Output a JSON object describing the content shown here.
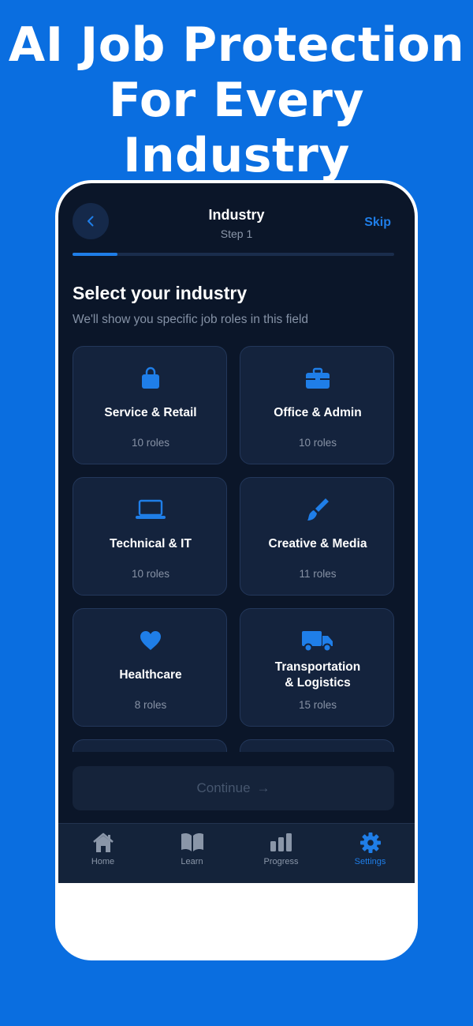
{
  "promo": {
    "line1": "AI Job Protection",
    "line2": "For Every Industry"
  },
  "header": {
    "title": "Industry",
    "step": "Step 1",
    "skip_label": "Skip",
    "back_icon": "chevron-left-icon"
  },
  "progress": {
    "fraction": 0.14
  },
  "heading": "Select your industry",
  "subheading": "We'll show you specific job roles in this field",
  "industries": [
    {
      "name": "Service & Retail",
      "roles": "10 roles",
      "icon": "shopping-bag-icon"
    },
    {
      "name": "Office & Admin",
      "roles": "10 roles",
      "icon": "briefcase-icon"
    },
    {
      "name": "Technical & IT",
      "roles": "10 roles",
      "icon": "laptop-icon"
    },
    {
      "name": "Creative & Media",
      "roles": "11 roles",
      "icon": "paintbrush-icon"
    },
    {
      "name": "Healthcare",
      "roles": "8 roles",
      "icon": "heart-icon"
    },
    {
      "name": "Transportation\n& Logistics",
      "roles": "15 roles",
      "icon": "truck-icon"
    }
  ],
  "continue": {
    "label": "Continue",
    "arrow": "→"
  },
  "tabs": [
    {
      "label": "Home",
      "icon": "house-icon",
      "active": false
    },
    {
      "label": "Learn",
      "icon": "book-icon",
      "active": false
    },
    {
      "label": "Progress",
      "icon": "bar-chart-icon",
      "active": false
    },
    {
      "label": "Settings",
      "icon": "gear-icon",
      "active": true
    }
  ],
  "colors": {
    "background": "#0a6ee0",
    "screen": "#0b1629",
    "card": "#14233d",
    "accent": "#1f7ee8"
  }
}
